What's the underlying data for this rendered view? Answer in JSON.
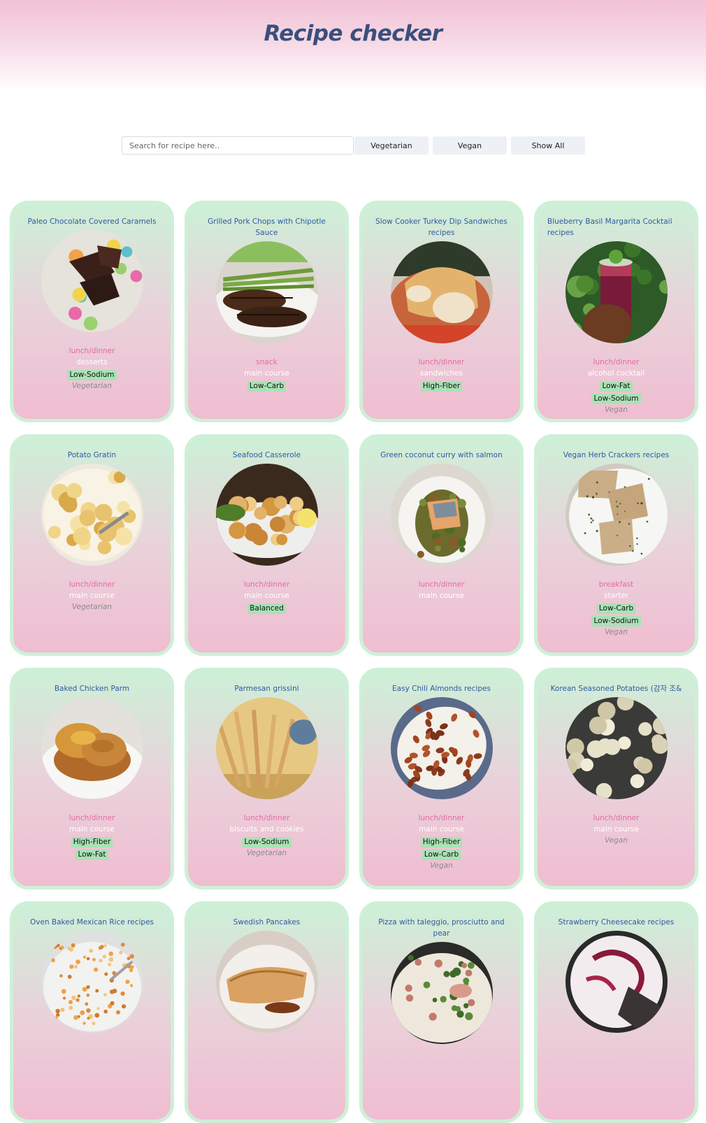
{
  "app": {
    "title": "Recipe checker"
  },
  "search": {
    "placeholder": "Search for recipe here.."
  },
  "filters": [
    {
      "label": "Vegetarian"
    },
    {
      "label": "Vegan"
    },
    {
      "label": "Show All"
    }
  ],
  "recipes": [
    {
      "title": "Paleo Chocolate Covered Caramels",
      "meal": "lunch/dinner",
      "dish": "desserts",
      "labels": [
        "Low-Sodium"
      ],
      "diet": "Vegetarian",
      "image": "caramels"
    },
    {
      "title": "Grilled Pork Chops with Chipotle Sauce",
      "meal": "snack",
      "dish": "main course",
      "labels": [
        "Low-Carb"
      ],
      "diet": "",
      "image": "porkchops"
    },
    {
      "title": "Slow Cooker Turkey Dip Sandwiches recipes",
      "meal": "lunch/dinner",
      "dish": "sandwiches",
      "labels": [
        "High-Fiber"
      ],
      "diet": "",
      "image": "sandwich"
    },
    {
      "title": "Blueberry Basil Margarita Cocktail recipes",
      "meal": "lunch/dinner",
      "dish": "alcohol cocktail",
      "labels": [
        "Low-Fat",
        "Low-Sodium"
      ],
      "diet": "Vegan",
      "image": "cocktail"
    },
    {
      "title": "Potato Gratin",
      "meal": "lunch/dinner",
      "dish": "main course",
      "labels": [],
      "diet": "Vegetarian",
      "image": "gratin"
    },
    {
      "title": "Seafood Casserole",
      "meal": "lunch/dinner",
      "dish": "main course",
      "labels": [
        "Balanced"
      ],
      "diet": "",
      "image": "casserole"
    },
    {
      "title": "Green coconut curry with salmon",
      "meal": "lunch/dinner",
      "dish": "main course",
      "labels": [],
      "diet": "",
      "image": "curry"
    },
    {
      "title": "Vegan Herb Crackers recipes",
      "meal": "breakfast",
      "dish": "starter",
      "labels": [
        "Low-Carb",
        "Low-Sodium"
      ],
      "diet": "Vegan",
      "image": "crackers"
    },
    {
      "title": "Baked Chicken Parm",
      "meal": "lunch/dinner",
      "dish": "main course",
      "labels": [
        "High-Fiber",
        "Low-Fat"
      ],
      "diet": "",
      "image": "parm"
    },
    {
      "title": "Parmesan grissini",
      "meal": "lunch/dinner",
      "dish": "biscuits and cookies",
      "labels": [
        "Low-Sodium"
      ],
      "diet": "Vegetarian",
      "image": "grissini"
    },
    {
      "title": "Easy Chili Almonds recipes",
      "meal": "lunch/dinner",
      "dish": "main course",
      "labels": [
        "High-Fiber",
        "Low-Carb"
      ],
      "diet": "Vegan",
      "image": "almonds"
    },
    {
      "title": "Korean Seasoned Potatoes (감자 조&",
      "meal": "lunch/dinner",
      "dish": "main course",
      "labels": [],
      "diet": "Vegan",
      "image": "potatoes"
    },
    {
      "title": "Oven Baked Mexican Rice recipes",
      "meal": "",
      "dish": "",
      "labels": [],
      "diet": "",
      "image": "rice"
    },
    {
      "title": "Swedish Pancakes",
      "meal": "",
      "dish": "",
      "labels": [],
      "diet": "",
      "image": "pancakes"
    },
    {
      "title": "Pizza with taleggio, prosciutto and pear",
      "meal": "",
      "dish": "",
      "labels": [],
      "diet": "",
      "image": "pizza"
    },
    {
      "title": "Strawberry Cheesecake recipes",
      "meal": "",
      "dish": "",
      "labels": [],
      "diet": "",
      "image": "cheesecake"
    }
  ]
}
